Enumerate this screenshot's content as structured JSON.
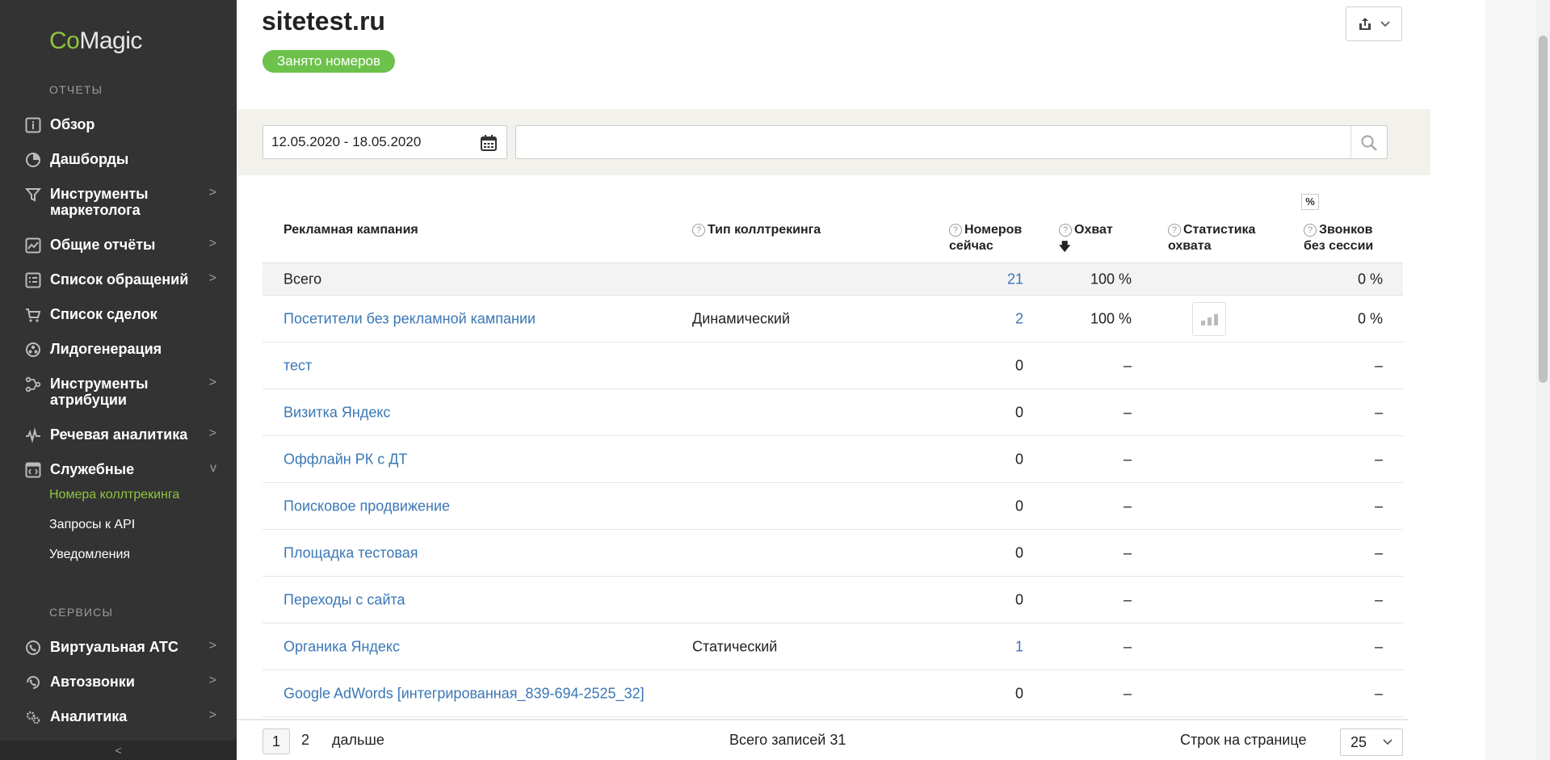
{
  "logo": {
    "part1": "Co",
    "part2": "Magic"
  },
  "sidebar": {
    "section_reports": "ОТЧЕТЫ",
    "items": [
      {
        "label": "Обзор",
        "arrow": ""
      },
      {
        "label": "Дашборды",
        "arrow": ""
      },
      {
        "label": "Инструменты маркетолога",
        "arrow": ">"
      },
      {
        "label": "Общие отчёты",
        "arrow": ">"
      },
      {
        "label": "Список обращений",
        "arrow": ">"
      },
      {
        "label": "Список сделок",
        "arrow": ""
      },
      {
        "label": "Лидогенерация",
        "arrow": ""
      },
      {
        "label": "Инструменты атрибуции",
        "arrow": ">"
      },
      {
        "label": "Речевая аналитика",
        "arrow": ">"
      },
      {
        "label": "Служебные",
        "arrow": "v"
      }
    ],
    "sub_items": [
      "Номера коллтрекинга",
      "Запросы к API",
      "Уведомления"
    ],
    "section_services": "СЕРВИСЫ",
    "service_items": [
      {
        "label": "Виртуальная АТС",
        "arrow": ">"
      },
      {
        "label": "Автозвонки",
        "arrow": ">"
      },
      {
        "label": "Аналитика",
        "arrow": ">"
      }
    ],
    "collapse": "<"
  },
  "header": {
    "title": "sitetest.ru",
    "badge": "Занято номеров"
  },
  "filters": {
    "date_range": "12.05.2020 - 18.05.2020",
    "search_placeholder": ""
  },
  "table": {
    "columns": {
      "campaign": "Рекламная кампания",
      "type": "Тип коллтрекинга",
      "numbers": "Номеров сейчас",
      "coverage": "Охват",
      "coverage_sort": "🡇",
      "stats": "Статистика охвата",
      "calls_pct_toggle": "%",
      "calls": "Звонков без сессии"
    },
    "total": {
      "label": "Всего",
      "numbers": "21",
      "coverage": "100 %",
      "calls": "0 %"
    },
    "rows": [
      {
        "name": "Посетители без рекламной кампании",
        "type": "Динамический",
        "numbers": "2",
        "coverage": "100 %",
        "calls": "0 %"
      },
      {
        "name": "тест",
        "type": "",
        "numbers": "0",
        "coverage": "–",
        "calls": "–"
      },
      {
        "name": "Визитка Яндекс",
        "type": "",
        "numbers": "0",
        "coverage": "–",
        "calls": "–"
      },
      {
        "name": "Оффлайн РК с ДТ",
        "type": "",
        "numbers": "0",
        "coverage": "–",
        "calls": "–"
      },
      {
        "name": "Поисковое продвижение",
        "type": "",
        "numbers": "0",
        "coverage": "–",
        "calls": "–"
      },
      {
        "name": "Площадка тестовая",
        "type": "",
        "numbers": "0",
        "coverage": "–",
        "calls": "–"
      },
      {
        "name": "Переходы с сайта",
        "type": "",
        "numbers": "0",
        "coverage": "–",
        "calls": "–"
      },
      {
        "name": "Органика Яндекс",
        "type": "Статический",
        "numbers": "1",
        "coverage": "–",
        "calls": "–"
      },
      {
        "name": "Google AdWords [интегрированная_839-694-2525_32]",
        "type": "",
        "numbers": "0",
        "coverage": "–",
        "calls": "–"
      }
    ]
  },
  "pagination": {
    "page1": "1",
    "page2": "2",
    "next": "дальше",
    "total": "Всего записей 31",
    "rows_label": "Строк на странице",
    "rows_value": "25"
  },
  "colors": {
    "accent": "#8dc63f",
    "badge": "#6cc24a",
    "link": "#3a77b5",
    "sidebar": "#333333"
  }
}
